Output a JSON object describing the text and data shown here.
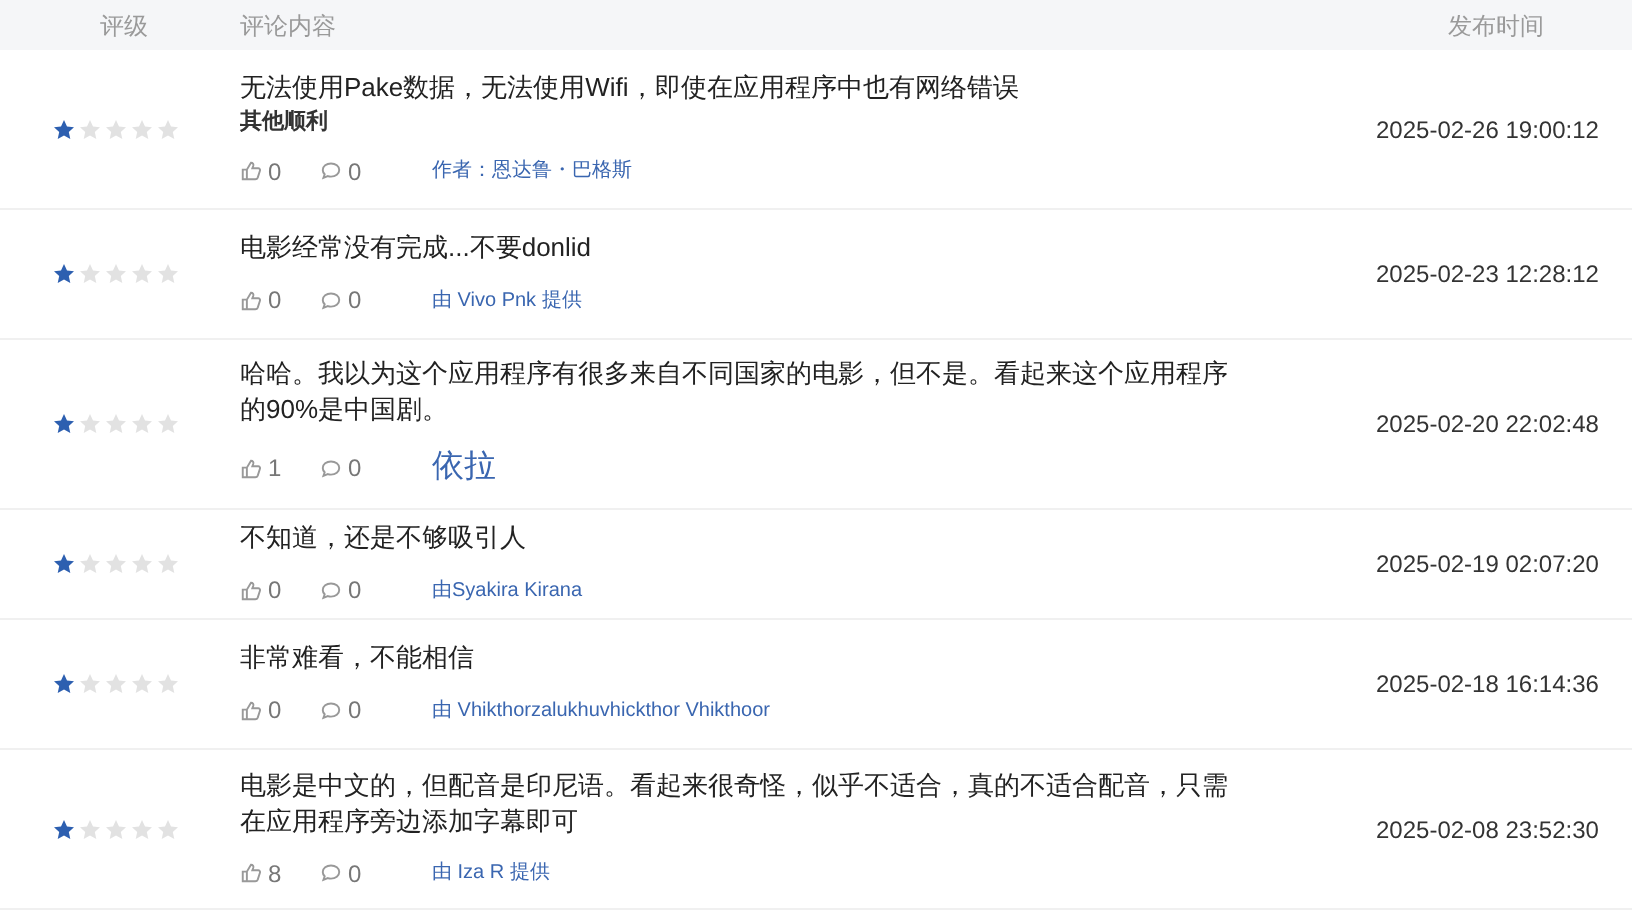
{
  "table": {
    "columns": [
      "评级",
      "评论内容",
      "发布时间"
    ],
    "rows": [
      {
        "stars": 1,
        "text": "无法使用Pake数据，无法使用Wifi，即使在应用程序中也有网络错误",
        "subtext": "其他顺利",
        "likes": "0",
        "comments": "0",
        "author": "作者：恩达鲁・巴格斯",
        "author_large": false,
        "time": "2025-02-26 19:00:12"
      },
      {
        "stars": 1,
        "text": "电影经常没有完成...不要donlid",
        "likes": "0",
        "comments": "0",
        "author": "由 Vivo Pnk 提供",
        "author_large": false,
        "time": "2025-02-23 12:28:12"
      },
      {
        "stars": 1,
        "text": "哈哈。我以为这个应用程序有很多来自不同国家的电影，但不是。看起来这个应用程序的90%是中国剧。",
        "likes": "1",
        "comments": "0",
        "author": "依拉",
        "author_large": true,
        "time": "2025-02-20 22:02:48"
      },
      {
        "stars": 1,
        "text": "不知道，还是不够吸引人",
        "likes": "0",
        "comments": "0",
        "author": "由Syakira Kirana",
        "author_large": false,
        "time": "2025-02-19 02:07:20"
      },
      {
        "stars": 1,
        "text": "非常难看，不能相信",
        "likes": "0",
        "comments": "0",
        "author": "由 Vhikthorzalukhuvhickthor Vhikthoor",
        "author_large": false,
        "time": "2025-02-18 16:14:36"
      },
      {
        "stars": 1,
        "text": "电影是中文的，但配音是印尼语。看起来很奇怪，似乎不适合，真的不适合配音，只需在应用程序旁边添加字幕即可",
        "likes": "8",
        "comments": "0",
        "author": "由 Iza R 提供",
        "author_large": false,
        "time": "2025-02-08 23:52:30"
      }
    ]
  }
}
